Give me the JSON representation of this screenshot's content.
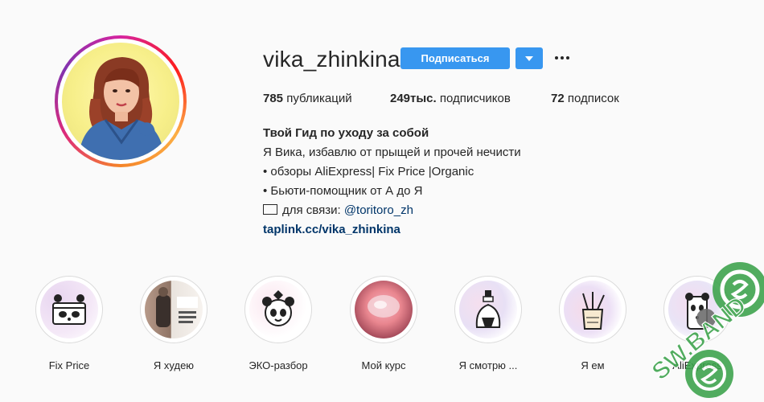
{
  "profile": {
    "username": "vika_zhinkina",
    "follow_label": "Подписаться"
  },
  "stats": {
    "posts_count": "785",
    "posts_label": "публикаций",
    "followers_count": "249тыс.",
    "followers_label": "подписчиков",
    "following_count": "72",
    "following_label": "подписок"
  },
  "bio": {
    "name": "Твой Гид по уходу за собой",
    "line1": "Я Вика, избавлю от прыщей и прочей нечисти",
    "line2": "• обзоры AliExpress| Fix Price |Organic",
    "line3": "• Бьюти-помощник от А до Я",
    "contact_label": "для связи: ",
    "contact_handle": "@toritoro_zh",
    "link": "taplink.cc/vika_zhinkina"
  },
  "highlights": [
    {
      "label": "Fix Price"
    },
    {
      "label": "Я худею"
    },
    {
      "label": "ЭКО-разбор"
    },
    {
      "label": "Мой курс"
    },
    {
      "label": "Я смотрю ..."
    },
    {
      "label": "Я ем"
    },
    {
      "label": "AliExpress"
    }
  ],
  "icons": {
    "dropdown": "chevron-down-icon",
    "more": "more-options-icon",
    "mail": "mail-icon"
  },
  "watermark": {
    "text": "SW.BAND"
  },
  "colors": {
    "accent": "#3897f0",
    "link": "#003569",
    "text": "#262626",
    "watermark": "#2e9e3a"
  }
}
